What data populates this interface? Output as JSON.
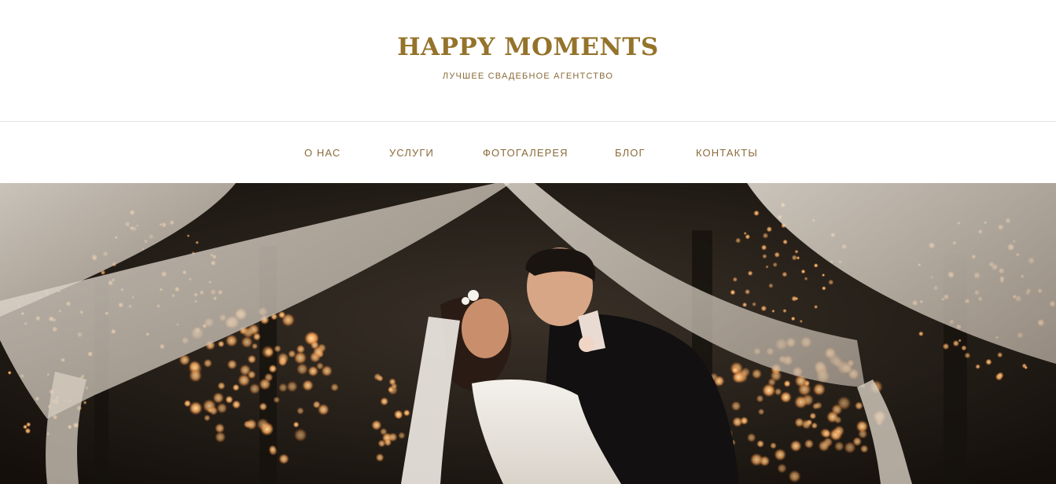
{
  "brand": {
    "title": "HAPPY MOMENTS",
    "tagline": "ЛУЧШЕЕ СВАДЕБНОЕ АГЕНТСТВО",
    "color": "#94732a"
  },
  "nav": {
    "items": [
      {
        "label": "О НАС"
      },
      {
        "label": "УСЛУГИ"
      },
      {
        "label": "ФОТОГАЛЕРЕЯ"
      },
      {
        "label": "БЛОГ"
      },
      {
        "label": "КОНТАКТЫ"
      }
    ],
    "color": "#8a6b3a"
  },
  "hero": {
    "image_subject": "wedding-couple-photo"
  }
}
